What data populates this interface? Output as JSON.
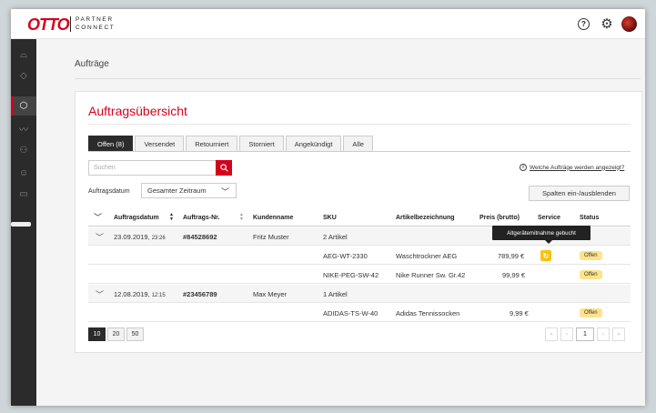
{
  "header": {
    "logo": "OTTO",
    "partner_line1": "PARTNER",
    "partner_line2": "CONNECT",
    "help_icon": "question-circle-icon",
    "settings_icon": "gear-icon"
  },
  "sidebar": {
    "items": [
      {
        "icon": "speedometer-icon",
        "glyph": "⌓"
      },
      {
        "icon": "tag-icon",
        "glyph": "◇"
      },
      {
        "icon": "box-icon",
        "glyph": "⬡",
        "active": true
      },
      {
        "icon": "activity-icon",
        "glyph": "〰"
      },
      {
        "icon": "people-icon",
        "glyph": "⚇"
      },
      {
        "icon": "user-icon",
        "glyph": "☺"
      },
      {
        "icon": "book-icon",
        "glyph": "▭"
      }
    ],
    "expand_glyph": "»"
  },
  "breadcrumb": "Aufträge",
  "page": {
    "title": "Auftragsübersicht",
    "tabs": [
      {
        "label": "Offen (8)",
        "active": true
      },
      {
        "label": "Versendet"
      },
      {
        "label": "Retourniert"
      },
      {
        "label": "Storniert"
      },
      {
        "label": "Angekündigt"
      },
      {
        "label": "Alle"
      }
    ],
    "search_placeholder": "Suchen",
    "info_link": "Welche Aufträge werden angezeigt?",
    "date_label": "Auftragsdatum",
    "date_select_value": "Gesamter Zeitraum",
    "columns_button": "Spalten ein-/ausblenden"
  },
  "table": {
    "headers": {
      "date": "Auftragsdatum",
      "order_no": "Auftrags-Nr.",
      "customer": "Kundenname",
      "sku": "SKU",
      "article": "Artikelbezeichnung",
      "price": "Preis (brutto)",
      "service": "Service",
      "status": "Status"
    },
    "orders": [
      {
        "date": "23.09.2019,",
        "time": "23:26",
        "order_no": "#84528692",
        "customer": "Fritz Muster",
        "article_count": "2 Artikel",
        "items": [
          {
            "sku": "AEG-WT-2330",
            "article": "Waschtrockner AEG",
            "price": "789,99 €",
            "service": true,
            "status": "Offen"
          },
          {
            "sku": "NIKE-PEG-SW-42",
            "article": "Nike Runner Sw. Gr.42",
            "price": "99,99 €",
            "service": false,
            "status": "Offen"
          }
        ]
      },
      {
        "date": "12.08.2019,",
        "time": "12:15",
        "order_no": "#23456789",
        "customer": "Max Meyer",
        "article_count": "1 Artikel",
        "items": [
          {
            "sku": "ADIDAS-TS-W-40",
            "article": "Adidas Tennissocken",
            "price": "9,99 €",
            "service": false,
            "status": "Offen"
          }
        ]
      }
    ]
  },
  "tooltip": "Altgerätemitnahme gebucht",
  "pagination": {
    "sizes": [
      "10",
      "20",
      "50"
    ],
    "active_size": "10",
    "first": "«",
    "prev": "‹",
    "current": "1",
    "next": "›",
    "last": "»"
  },
  "colors": {
    "brand": "#d4021d",
    "sidebar": "#2b2b2b",
    "badge": "#fde38a",
    "service": "#f7c30c"
  }
}
